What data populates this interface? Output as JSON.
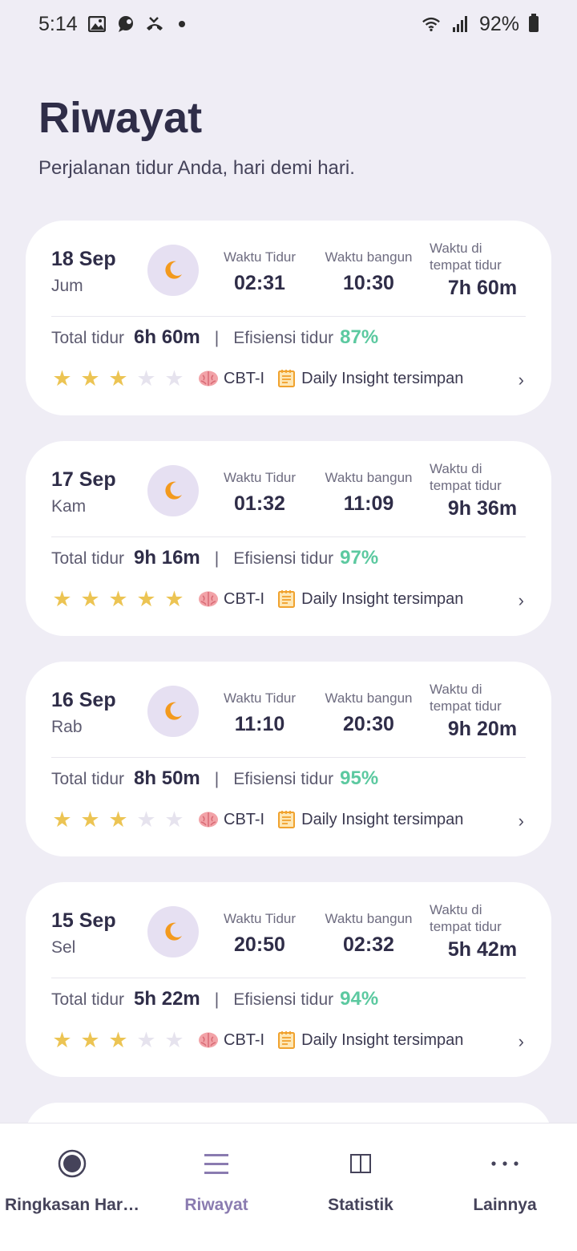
{
  "status_bar": {
    "time": "5:14",
    "battery": "92%",
    "icons": [
      "gallery-icon",
      "chat-icon",
      "missed-call-icon",
      "dot-icon",
      "wifi-icon",
      "signal-icon",
      "battery-icon"
    ]
  },
  "header": {
    "title": "Riwayat",
    "subtitle": "Perjalanan tidur Anda, hari demi hari."
  },
  "labels": {
    "bedtime": "Waktu Tidur",
    "wake": "Waktu bangun",
    "in_bed": "Waktu di tempat tidur",
    "total_sleep": "Total tidur",
    "separator": "|",
    "efficiency": "Efisiensi tidur",
    "cbt": "CBT-I",
    "insight": "Daily Insight tersimpan",
    "chevron": "›"
  },
  "entries": [
    {
      "date": "18 Sep",
      "day": "Jum",
      "bedtime": "02:31",
      "wake": "10:30",
      "in_bed": "7h 60m",
      "total": "6h 60m",
      "efficiency": "87%",
      "rating": 3
    },
    {
      "date": "17 Sep",
      "day": "Kam",
      "bedtime": "01:32",
      "wake": "11:09",
      "in_bed": "9h 36m",
      "total": "9h 16m",
      "efficiency": "97%",
      "rating": 5
    },
    {
      "date": "16 Sep",
      "day": "Rab",
      "bedtime": "11:10",
      "wake": "20:30",
      "in_bed": "9h 20m",
      "total": "8h 50m",
      "efficiency": "95%",
      "rating": 3
    },
    {
      "date": "15 Sep",
      "day": "Sel",
      "bedtime": "20:50",
      "wake": "02:32",
      "in_bed": "5h 42m",
      "total": "5h 22m",
      "efficiency": "94%",
      "rating": 3
    }
  ],
  "nav": {
    "items": [
      {
        "label": "Ringkasan Har…",
        "icon": "radio-circle-icon",
        "active": false
      },
      {
        "label": "Riwayat",
        "icon": "list-icon",
        "active": true
      },
      {
        "label": "Statistik",
        "icon": "columns-icon",
        "active": false
      },
      {
        "label": "Lainnya",
        "icon": "more-dots-icon",
        "active": false
      }
    ]
  },
  "colors": {
    "background": "#efedf5",
    "accent": "#8a7bb0",
    "efficiency": "#5cc9a0",
    "star": "#ecc453",
    "moon": "#f39a1e"
  }
}
